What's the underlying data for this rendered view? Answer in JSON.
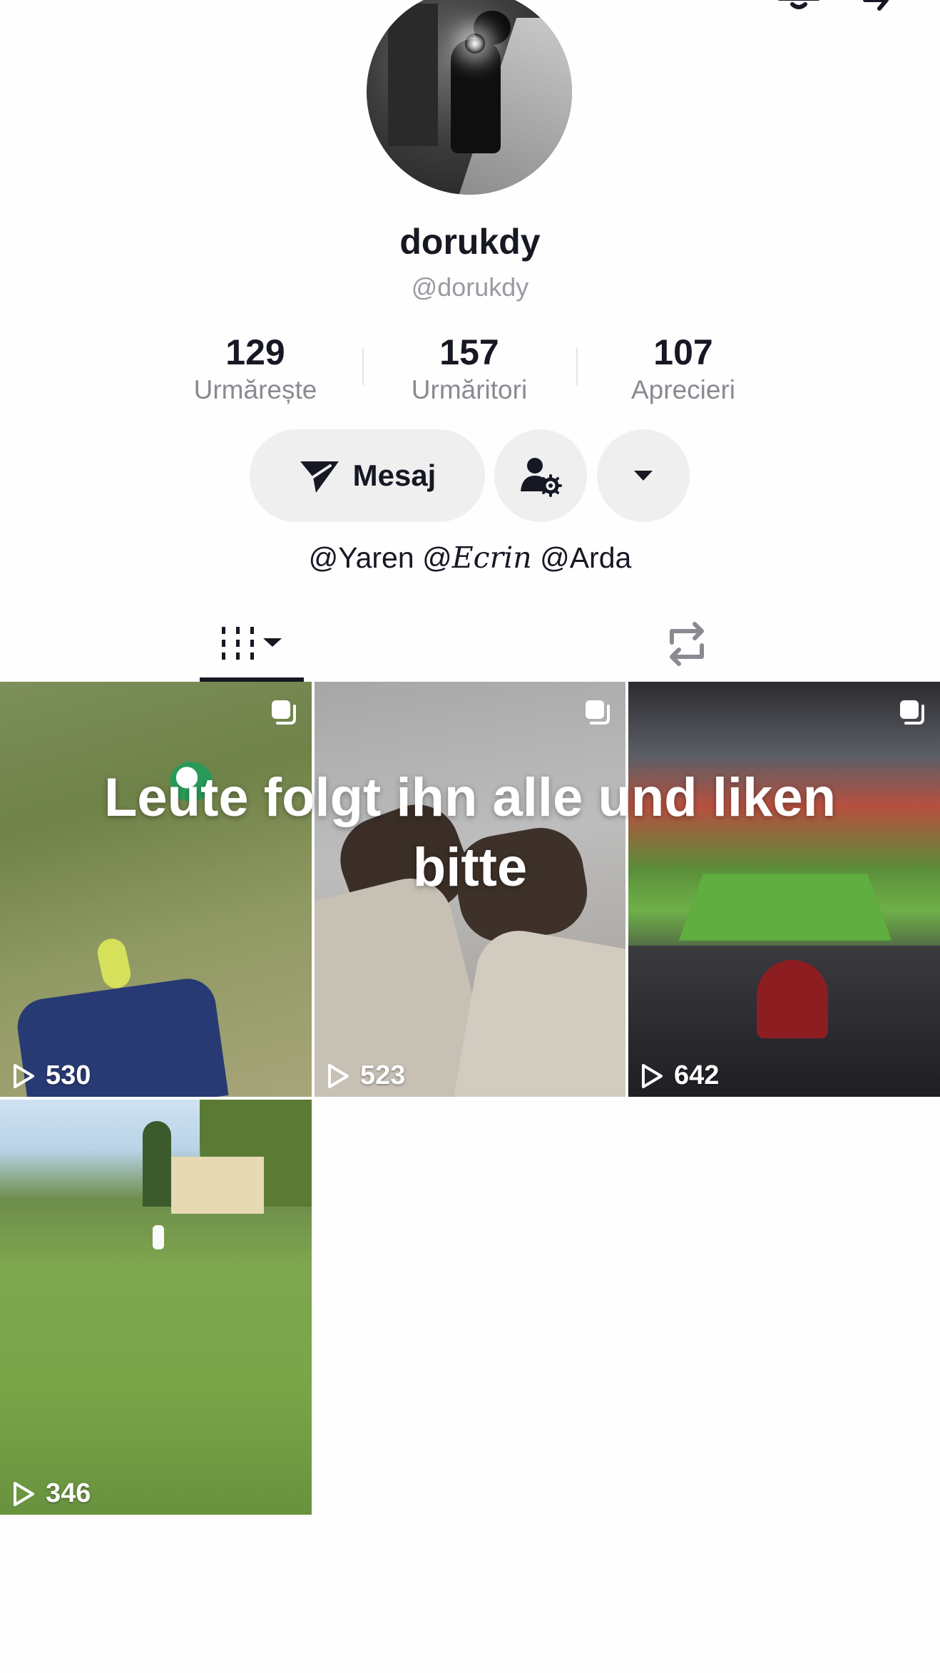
{
  "profile": {
    "display_name": "dorukdy",
    "handle": "@dorukdy",
    "bio_parts": [
      "@Yaren ",
      "@",
      "𝐸𝑐𝑟𝑖𝑛",
      " @Arda"
    ]
  },
  "stats": [
    {
      "value": "129",
      "label": "Urmărește"
    },
    {
      "value": "157",
      "label": "Urmăritori"
    },
    {
      "value": "107",
      "label": "Aprecieri"
    }
  ],
  "actions": {
    "message_label": "Mesaj",
    "message_icon": "paper-plane-icon",
    "friends_icon": "person-gear-icon",
    "more_icon": "caret-down-icon"
  },
  "tabs": [
    {
      "icon": "grid-columns-icon",
      "active": true
    },
    {
      "icon": "repost-icon",
      "active": false
    }
  ],
  "videos": [
    {
      "views": "530",
      "multi": true
    },
    {
      "views": "523",
      "multi": true
    },
    {
      "views": "642",
      "multi": true
    },
    {
      "views": "346",
      "multi": false
    }
  ],
  "caption_overlay": "Leute folgt ihn alle und liken bitte",
  "colors": {
    "text_primary": "#161823",
    "text_secondary": "#8a8b91",
    "button_bg": "#efefef"
  }
}
